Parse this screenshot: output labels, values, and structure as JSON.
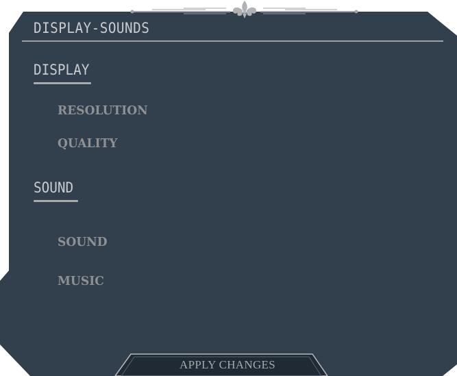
{
  "panel": {
    "title": "DISPLAY-SOUNDS",
    "background_color": "#323f4c"
  },
  "sections": {
    "display": {
      "heading": "DISPLAY",
      "options": [
        "RESOLUTION",
        "QUALITY"
      ]
    },
    "sound": {
      "heading": "SOUND",
      "options": [
        "SOUND",
        "MUSIC"
      ]
    }
  },
  "footer": {
    "apply_label": "APPLY CHANGES"
  },
  "icons": {
    "crest": "fleur-de-lis-icon"
  }
}
